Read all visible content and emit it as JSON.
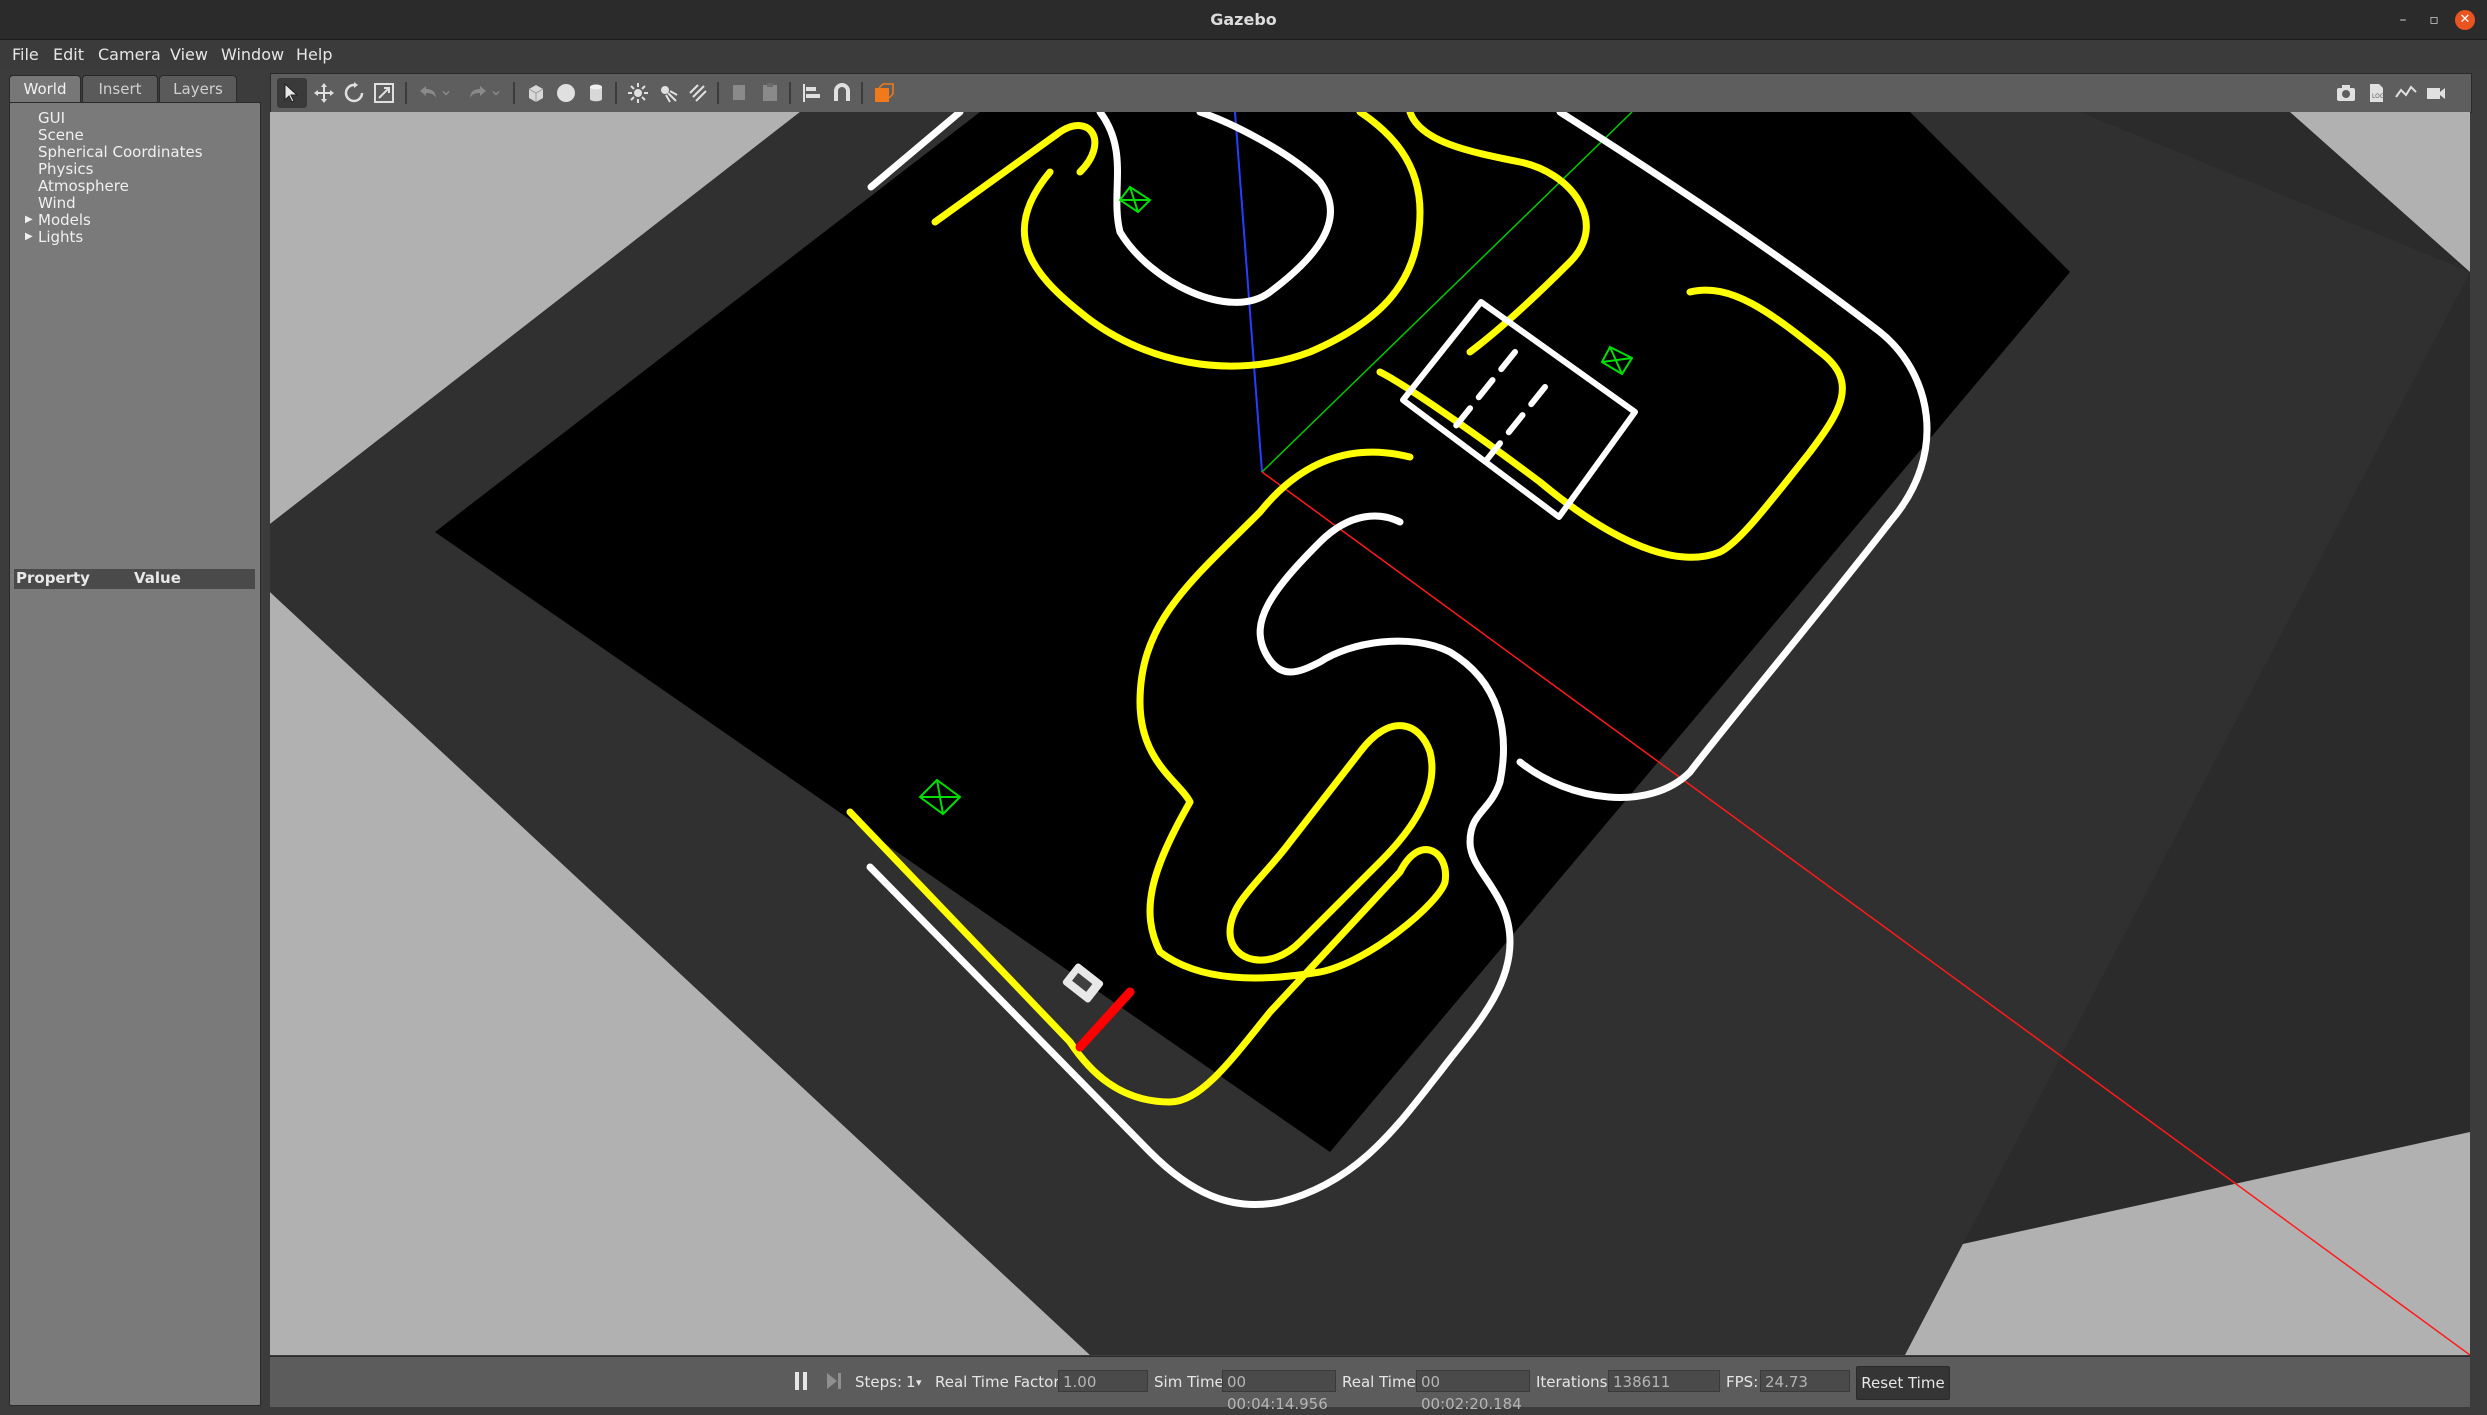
{
  "window": {
    "title": "Gazebo"
  },
  "menu": [
    "File",
    "Edit",
    "Camera",
    "View",
    "Window",
    "Help"
  ],
  "left_panel": {
    "tabs": [
      "World",
      "Insert",
      "Layers"
    ],
    "active_tab": "World",
    "tree": [
      {
        "label": "GUI",
        "expandable": false
      },
      {
        "label": "Scene",
        "expandable": false
      },
      {
        "label": "Spherical Coordinates",
        "expandable": false
      },
      {
        "label": "Physics",
        "expandable": false
      },
      {
        "label": "Atmosphere",
        "expandable": false
      },
      {
        "label": "Wind",
        "expandable": false
      },
      {
        "label": "Models",
        "expandable": true
      },
      {
        "label": "Lights",
        "expandable": true
      }
    ],
    "property_header": {
      "property": "Property",
      "value": "Value"
    }
  },
  "toolbar": {
    "left_tools": [
      "select-mode-icon",
      "translate-mode-icon",
      "rotate-mode-icon",
      "scale-mode-icon",
      "undo-icon",
      "undo-history-icon",
      "redo-icon",
      "redo-history-icon",
      "box-shape-icon",
      "sphere-shape-icon",
      "cylinder-shape-icon",
      "point-light-icon",
      "spot-light-icon",
      "directional-light-icon",
      "copy-icon",
      "paste-icon",
      "align-icon",
      "snap-icon",
      "change-view-icon"
    ],
    "right_tools": [
      "screenshot-icon",
      "log-icon",
      "plot-icon",
      "video-record-icon"
    ]
  },
  "status_bar": {
    "steps_label": "Steps:",
    "steps_value": "1",
    "rtf_label": "Real Time Factor:",
    "rtf_value": "1.00",
    "sim_time_label": "Sim Time:",
    "sim_time_value": "00 00:04:14.956",
    "real_time_label": "Real Time:",
    "real_time_value": "00 00:02:20.184",
    "iterations_label": "Iterations:",
    "iterations_value": "138611",
    "fps_label": "FPS:",
    "fps_value": "24.73",
    "reset_label": "Reset Time"
  },
  "colors": {
    "accent": "#e95420",
    "lane_yellow": "#ffff00",
    "lane_white": "#ffffff",
    "stop_line": "#ff0000"
  }
}
